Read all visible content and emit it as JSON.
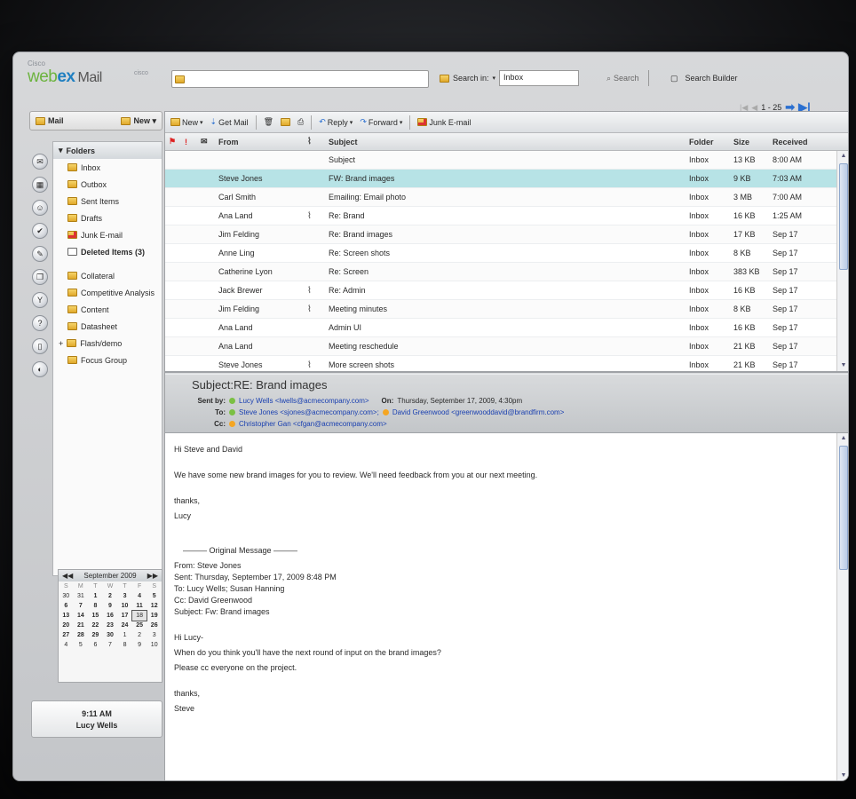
{
  "brand": {
    "cisco": "Cisco",
    "logo_web": "web",
    "logo_ex": "ex",
    "logo_mail": "Mail",
    "cisco_mark": "cisco"
  },
  "tabstrip": {
    "mail_label": "Mail",
    "new_label": "New ▾"
  },
  "rail_icons": [
    "mail-icon",
    "calendar-icon",
    "contacts-icon",
    "tasks-icon",
    "notes-icon",
    "journal-icon",
    "filter-icon",
    "help-icon",
    "document-icon",
    "settings-icon"
  ],
  "folders": {
    "header": "Folders",
    "items": [
      {
        "label": "Inbox",
        "sub": true,
        "bold": false
      },
      {
        "label": "Outbox",
        "sub": true,
        "bold": false
      },
      {
        "label": "Sent Items",
        "sub": true,
        "bold": false
      },
      {
        "label": "Drafts",
        "sub": true,
        "bold": false
      },
      {
        "label": "Junk E-mail",
        "sub": true,
        "bold": false
      },
      {
        "label": "Deleted Items (3)",
        "sub": true,
        "bold": true
      },
      {
        "label": "Collateral",
        "sub": false,
        "bold": false
      },
      {
        "label": "Competitive Analysis",
        "sub": false,
        "bold": false
      },
      {
        "label": "Content",
        "sub": false,
        "bold": false
      },
      {
        "label": "Datasheet",
        "sub": false,
        "bold": false
      },
      {
        "label": "Flash/demo",
        "sub": false,
        "bold": false
      },
      {
        "label": "Focus Group",
        "sub": false,
        "bold": false
      }
    ]
  },
  "calendar": {
    "month": "September 2009",
    "dow": [
      "S",
      "M",
      "T",
      "W",
      "T",
      "F",
      "S"
    ],
    "days": [
      "30",
      "31",
      "1",
      "2",
      "3",
      "4",
      "5",
      "6",
      "7",
      "8",
      "9",
      "10",
      "11",
      "12",
      "13",
      "14",
      "15",
      "16",
      "17",
      "18",
      "19",
      "20",
      "21",
      "22",
      "23",
      "24",
      "25",
      "26",
      "27",
      "28",
      "29",
      "30",
      "1",
      "2",
      "3",
      "4",
      "5",
      "6",
      "7",
      "8",
      "9",
      "10"
    ],
    "today": "18"
  },
  "clock": {
    "time": "9:11 AM",
    "user": "Lucy Wells"
  },
  "search": {
    "placeholder": "",
    "search_in_label": "Search in:",
    "search_in_value": "Inbox",
    "search_button": "Search",
    "builder_button": "Search Builder"
  },
  "pager": {
    "range": "1 - 25"
  },
  "toolbar": {
    "new": "New",
    "get_mail": "Get Mail",
    "reply": "Reply",
    "forward": "Forward",
    "junk": "Junk E-mail"
  },
  "columns": {
    "from": "From",
    "subject": "Subject",
    "folder": "Folder",
    "size": "Size",
    "received": "Received"
  },
  "messages": [
    {
      "from": "",
      "subject": "Subject",
      "folder": "Inbox",
      "size": "13 KB",
      "received": "8:00 AM",
      "attach": false,
      "selected": true,
      "flagged": true
    },
    {
      "from": "Steve Jones",
      "subject": "FW: Brand images",
      "folder": "Inbox",
      "size": "9 KB",
      "received": "7:03 AM",
      "attach": false,
      "selected": true,
      "flagged": false
    },
    {
      "from": "Carl Smith",
      "subject": "Emailing: Email photo",
      "folder": "Inbox",
      "size": "3 MB",
      "received": "7:00 AM",
      "attach": false,
      "selected": false,
      "flagged": false
    },
    {
      "from": "Ana Land",
      "subject": "Re: Brand",
      "folder": "Inbox",
      "size": "16 KB",
      "received": "1:25 AM",
      "attach": true,
      "selected": false,
      "flagged": false
    },
    {
      "from": "Jim Felding",
      "subject": "Re: Brand images",
      "folder": "Inbox",
      "size": "17 KB",
      "received": "Sep 17",
      "attach": false,
      "selected": false,
      "flagged": false
    },
    {
      "from": "Anne Ling",
      "subject": "Re: Screen shots",
      "folder": "Inbox",
      "size": "8 KB",
      "received": "Sep 17",
      "attach": false,
      "selected": false,
      "flagged": false
    },
    {
      "from": "Catherine Lyon",
      "subject": "Re: Screen",
      "folder": "Inbox",
      "size": "383 KB",
      "received": "Sep 17",
      "attach": false,
      "selected": false,
      "flagged": false
    },
    {
      "from": "Jack Brewer",
      "subject": "Re: Admin",
      "folder": "Inbox",
      "size": "16 KB",
      "received": "Sep 17",
      "attach": true,
      "selected": false,
      "flagged": false
    },
    {
      "from": "Jim Felding",
      "subject": "Meeting minutes",
      "folder": "Inbox",
      "size": "8 KB",
      "received": "Sep 17",
      "attach": true,
      "selected": false,
      "flagged": false
    },
    {
      "from": "Ana Land",
      "subject": "Admin UI",
      "folder": "Inbox",
      "size": "16 KB",
      "received": "Sep 17",
      "attach": false,
      "selected": false,
      "flagged": false
    },
    {
      "from": "Ana Land",
      "subject": "Meeting reschedule",
      "folder": "Inbox",
      "size": "21 KB",
      "received": "Sep 17",
      "attach": false,
      "selected": false,
      "flagged": false
    },
    {
      "from": "Steve Jones",
      "subject": "More screen shots",
      "folder": "Inbox",
      "size": "21 KB",
      "received": "Sep 17",
      "attach": true,
      "selected": false,
      "flagged": false
    }
  ],
  "preview": {
    "subject": "Subject:RE: Brand images",
    "sent_by_label": "Sent by:",
    "sent_by": "Lucy Wells <lwells@acmecompany.com>",
    "on_label": "On:",
    "on": "Thursday, September 17, 2009, 4:30pm",
    "to_label": "To:",
    "to_1": "Steve Jones <sjones@acmecompany.com>;",
    "to_2": "David Greenwood <greenwooddavid@brandfirm.com>",
    "cc_label": "Cc:",
    "cc": "Christopher Gan <cfgan@acmecompany.com>",
    "body": {
      "greeting": "Hi Steve and David",
      "para": "We have some new brand images for you to review. We'll need feedback from you at our next meeting.",
      "thanks": "thanks,",
      "sign": "Lucy",
      "orig_sep": "——— Original Message ———",
      "orig_from": "From: Steve Jones",
      "orig_sent": "Sent: Thursday, September 17, 2009  8:48 PM",
      "orig_to": "To: Lucy Wells; Susan Hanning",
      "orig_cc": "Cc: David Greenwood",
      "orig_subject": "Subject: Fw: Brand images",
      "hi": "Hi Lucy-",
      "q": "When do you think you'll have the next round of input on the brand images?",
      "please": "Please cc everyone on the project.",
      "thanks2": "thanks,",
      "sign2": "Steve"
    }
  }
}
